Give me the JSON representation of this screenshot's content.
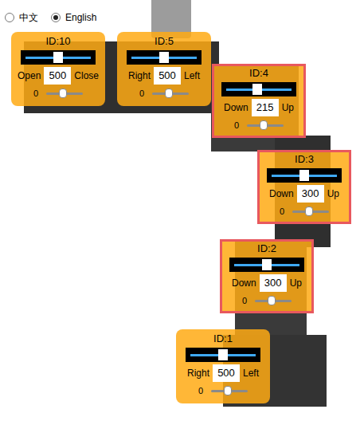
{
  "language": [
    {
      "label": "中文",
      "selected": false
    },
    {
      "label": "English",
      "selected": true
    }
  ],
  "servos": [
    {
      "id": "ID:10",
      "left_label": "Open",
      "value": "500",
      "right_label": "Close",
      "level": 0.5,
      "offset": "0",
      "offset_level": 0.45,
      "highlighted": false
    },
    {
      "id": "ID:5",
      "left_label": "Right",
      "value": "500",
      "right_label": "Left",
      "level": 0.5,
      "offset": "0",
      "offset_level": 0.45,
      "highlighted": false
    },
    {
      "id": "ID:4",
      "left_label": "Down",
      "value": "215",
      "right_label": "Up",
      "level": 0.48,
      "offset": "0",
      "offset_level": 0.45,
      "highlighted": true
    },
    {
      "id": "ID:3",
      "left_label": "Down",
      "value": "300",
      "right_label": "Up",
      "level": 0.5,
      "offset": "0",
      "offset_level": 0.45,
      "highlighted": true
    },
    {
      "id": "ID:2",
      "left_label": "Down",
      "value": "300",
      "right_label": "Up",
      "level": 0.5,
      "offset": "0",
      "offset_level": 0.45,
      "highlighted": true
    },
    {
      "id": "ID:1",
      "left_label": "Right",
      "value": "500",
      "right_label": "Left",
      "level": 0.5,
      "offset": "0",
      "offset_level": 0.45,
      "highlighted": false
    }
  ]
}
